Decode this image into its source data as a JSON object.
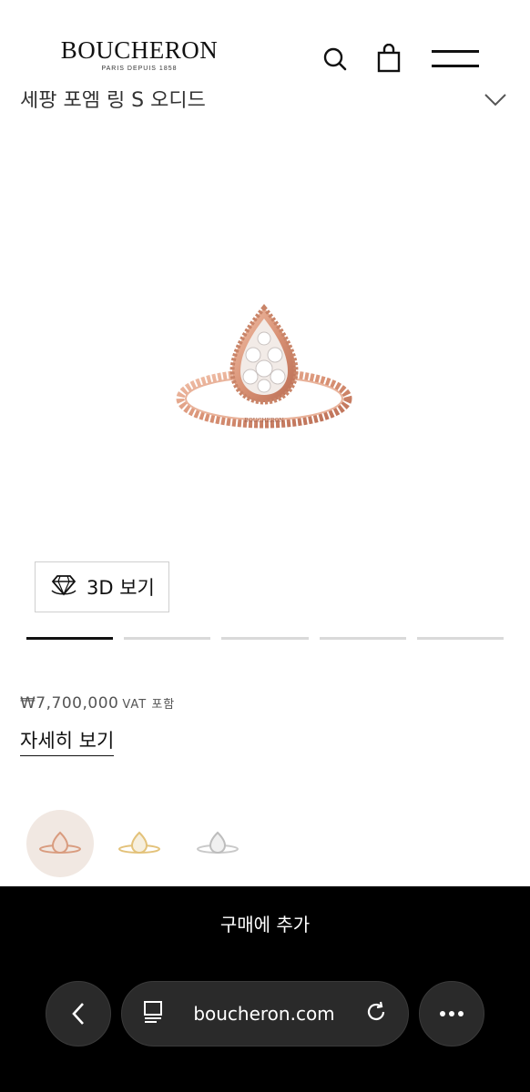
{
  "header": {
    "brand": "BOUCHERON",
    "tagline": "PARIS DEPUIS 1858",
    "search_icon": "search-icon",
    "bag_icon": "shopping-bag-icon",
    "menu_icon": "hamburger-menu-icon"
  },
  "product": {
    "partial_title": "세팡 포엠 링 S 오디드",
    "image_alt": "rose gold pear diamond ring",
    "view_3d_label": "3D 보기",
    "gallery_count": 5,
    "gallery_active_index": 0,
    "price": "₩7,700,000",
    "vat_label": "VAT 포함",
    "details_link": "자세히 보기",
    "variants": [
      {
        "name": "rose gold",
        "color": "#e7b49a",
        "selected": true
      },
      {
        "name": "yellow gold",
        "color": "#e3c27a",
        "selected": false
      },
      {
        "name": "white gold",
        "color": "#c9c9c9",
        "selected": false
      }
    ]
  },
  "cta": {
    "add_to_cart": "구매에 추가"
  },
  "browser": {
    "url": "boucheron.com",
    "back_icon": "back-arrow-icon",
    "tabs_icon": "page-tabs-icon",
    "reload_icon": "reload-icon",
    "more_icon": "more-dots-icon"
  },
  "colors": {
    "accent": "#000000",
    "rose_gold": "#d99c7f",
    "pill_bg": "#2a2a2a"
  }
}
